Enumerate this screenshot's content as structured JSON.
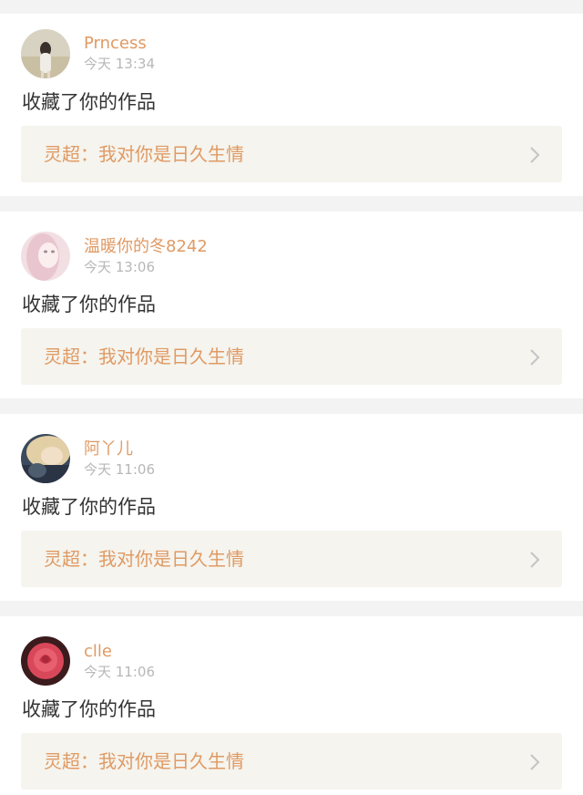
{
  "items": [
    {
      "username": "Prncess",
      "time": "今天 13:34",
      "action": "收藏了你的作品",
      "ref": "灵超：我对你是日久生情",
      "avatar_icon": "girl-in-field-avatar"
    },
    {
      "username": "温暖你的冬8242",
      "time": "今天 13:06",
      "action": "收藏了你的作品",
      "ref": "灵超：我对你是日久生情",
      "avatar_icon": "pink-portrait-avatar"
    },
    {
      "username": "阿丫儿",
      "time": "今天 11:06",
      "action": "收藏了你的作品",
      "ref": "灵超：我对你是日久生情",
      "avatar_icon": "blonde-portrait-avatar"
    },
    {
      "username": "clle",
      "time": "今天 11:06",
      "action": "收藏了你的作品",
      "ref": "灵超：我对你是日久生情",
      "avatar_icon": "rose-avatar"
    }
  ],
  "colors": {
    "accent": "#e09a64",
    "time_gray": "#b7b7b7",
    "text_dark": "#333333",
    "ref_bg": "#f5f4ee",
    "separator": "#f3f3f3"
  }
}
